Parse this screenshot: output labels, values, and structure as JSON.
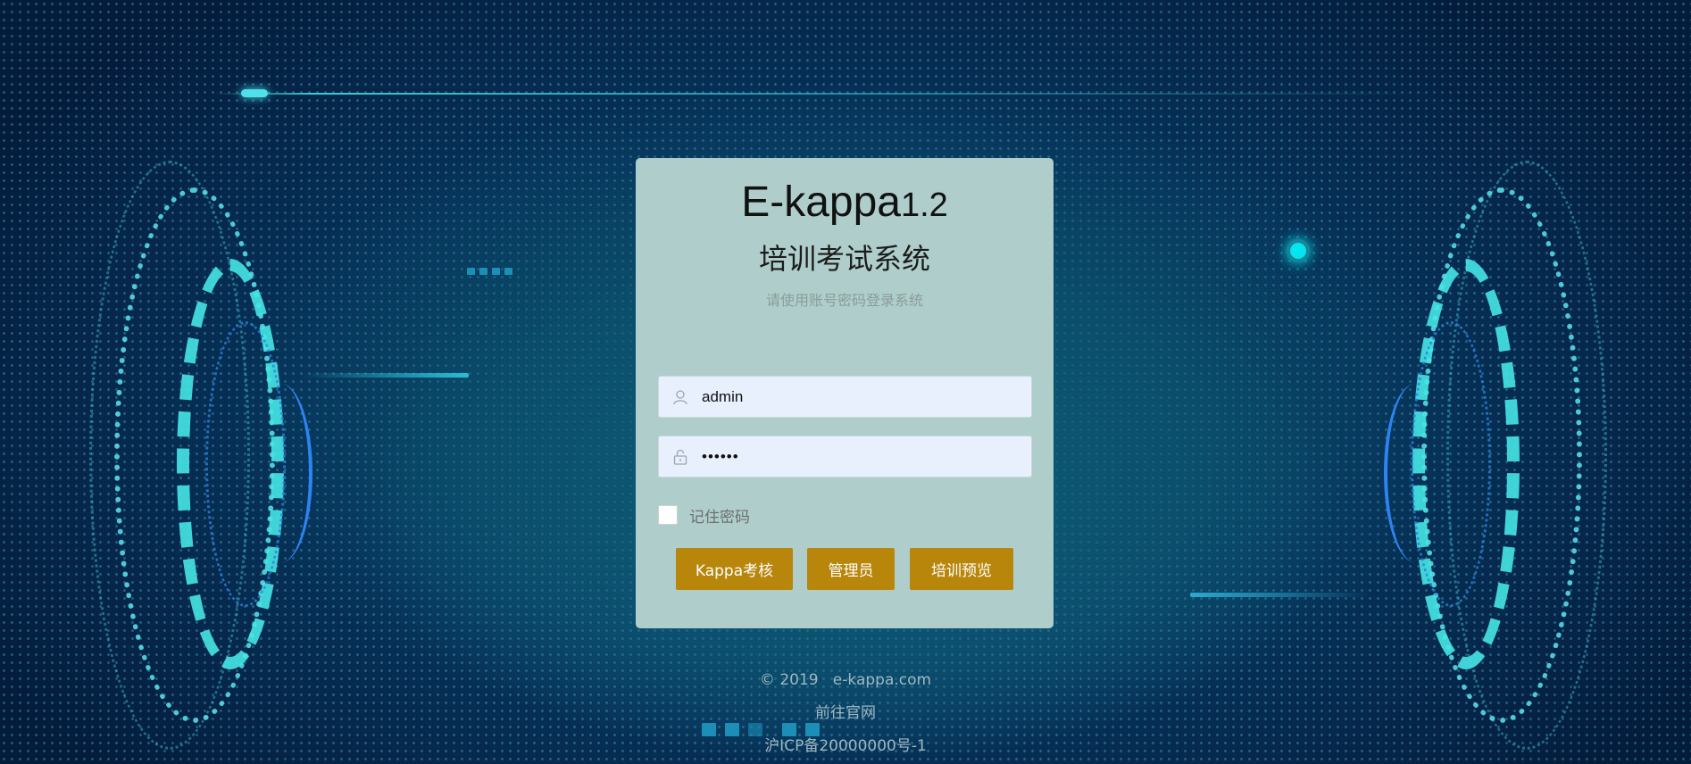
{
  "app": {
    "title": "E-kappa",
    "version": "1.2",
    "subtitle": "培训考试系统",
    "hint": "请使用账号密码登录系统"
  },
  "form": {
    "username_value": "admin",
    "password_value": "••••••",
    "remember_label": "记住密码",
    "remember_checked": false
  },
  "buttons": {
    "kappa_exam": "Kappa考核",
    "admin": "管理员",
    "training_preview": "培训预览"
  },
  "footer": {
    "copyright": "© 2019   e-kappa.com",
    "official_site": "前往官网",
    "icp": "沪ICP备20000000号-1"
  },
  "icons": {
    "user": "user-icon",
    "lock": "lock-icon"
  },
  "colors": {
    "card_bg": "#afcecb",
    "button_bg": "#b8860b",
    "input_bg": "#e8f0fe",
    "accent_cyan": "#37e3ea"
  }
}
